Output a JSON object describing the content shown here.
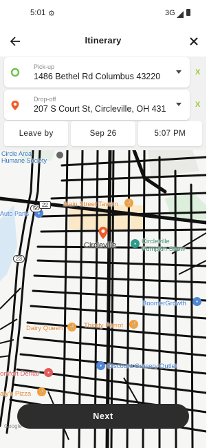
{
  "status_bar": {
    "time": "5:01",
    "network": "3G"
  },
  "app_bar": {
    "title": "Itinerary"
  },
  "pickup": {
    "label": "Pick-up",
    "value": "1486 Bethel Rd Columbus 43220",
    "clear": "X",
    "icon": "pickup-circle-icon",
    "color": "#6cc24a"
  },
  "dropoff": {
    "label": "Drop-off",
    "value": "207 S Court St, Circleville, OH 431",
    "clear": "X",
    "icon": "map-pin-icon",
    "color": "#f05a28"
  },
  "schedule": {
    "mode": "Leave by",
    "date": "Sep 26",
    "time": "5:07 PM"
  },
  "map": {
    "places": {
      "humane_society": "Circle Area\nHumane Society",
      "auto_parts": "Auto Parts",
      "main_street_tavern": "Main Street Tavern",
      "circleville": "Circleville",
      "pumpkin_show": "Circleville\nPumpkin Show",
      "boomer_growth": "BoomerGrowth",
      "dairy_queen": "Dairy Queen",
      "thirsty_parrot": "Thirsty Parrot",
      "discount_grocery": "Discount Grocery Outlet",
      "comfort_dental": "omfort Dental",
      "pizza": "aty's Pizza",
      "route_56": "56",
      "route_22": "22",
      "route_23": "23"
    }
  },
  "footer": {
    "next_label": "Next",
    "google": "Google"
  }
}
